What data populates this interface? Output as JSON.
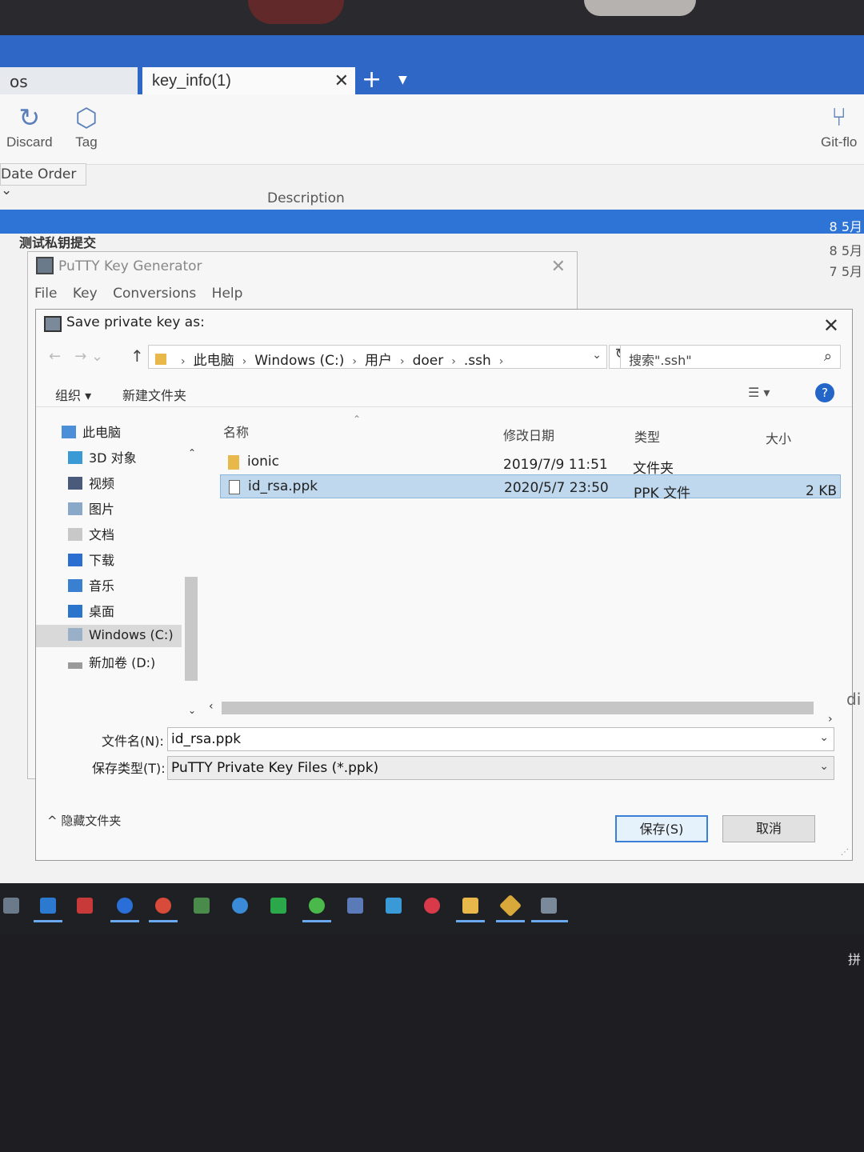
{
  "app": {
    "tabs": [
      {
        "label": "os"
      },
      {
        "label": "key_info(1)",
        "close": "✕"
      }
    ],
    "new_tab": "+",
    "toolbar": {
      "discard": "Discard",
      "tag": "Tag",
      "gitflow": "Git-flo"
    },
    "date_order": "Date Order ⌄",
    "description_header": "Description",
    "commit_message": "测试私钥提交",
    "dates": [
      "8 5月",
      "8 5月",
      "7 5月"
    ]
  },
  "putty": {
    "title": "PuTTY Key Generator",
    "menu": [
      "File",
      "Key",
      "Conversions",
      "Help"
    ]
  },
  "dialog": {
    "title": "Save private key as:",
    "breadcrumb": [
      "此电脑",
      "Windows (C:)",
      "用户",
      "doer",
      ".ssh"
    ],
    "search_placeholder": "搜索\".ssh\"",
    "organize": "组织 ▾",
    "new_folder": "新建文件夹",
    "help": "?",
    "nav_items": [
      {
        "label": "此电脑",
        "icon": "computer-icon"
      },
      {
        "label": "3D 对象",
        "icon": "cube-icon"
      },
      {
        "label": "视频",
        "icon": "video-icon"
      },
      {
        "label": "图片",
        "icon": "picture-icon"
      },
      {
        "label": "文档",
        "icon": "document-icon"
      },
      {
        "label": "下载",
        "icon": "download-icon"
      },
      {
        "label": "音乐",
        "icon": "music-icon"
      },
      {
        "label": "桌面",
        "icon": "desktop-icon"
      },
      {
        "label": "Windows (C:)",
        "icon": "drive-icon"
      },
      {
        "label": "新加卷 (D:)",
        "icon": "drive-icon"
      }
    ],
    "columns": {
      "name": "名称",
      "modified": "修改日期",
      "type": "类型",
      "size": "大小"
    },
    "files": [
      {
        "name": "ionic",
        "modified": "2019/7/9 11:51",
        "type": "文件夹",
        "size": ""
      },
      {
        "name": "id_rsa.ppk",
        "modified": "2020/5/7 23:50",
        "type": "PPK 文件",
        "size": "2 KB"
      }
    ],
    "filename_label": "文件名(N):",
    "filename_value": "id_rsa.ppk",
    "filetype_label": "保存类型(T):",
    "filetype_value": "PuTTY Private Key Files (*.ppk)",
    "hide_folders": "^ 隐藏文件夹",
    "save_button": "保存(S)",
    "cancel_button": "取消"
  },
  "side_text": "di",
  "ime_indicator": "拼",
  "colors": {
    "accent": "#2e67c6",
    "selection": "#bfd8ee",
    "help_blue": "#2466c8"
  }
}
